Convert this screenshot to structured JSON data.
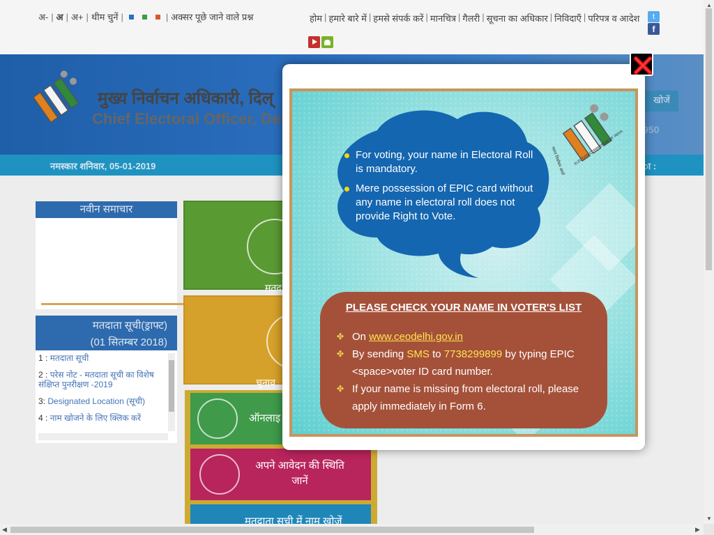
{
  "accessibility": {
    "font_decrease": "अ-",
    "font_normal": "अ",
    "font_increase": "अ+",
    "theme_label": "थीम चुनें",
    "theme_colors": [
      "#2b6fbf",
      "#3f9a4a",
      "#d9572a"
    ],
    "faq": "अक्सर पूछे जाने वाले प्रश्न"
  },
  "topnav": {
    "items": [
      "होम",
      "हमारे बारे में",
      "हमसे संपर्क करें",
      "मानचित्र",
      "गैलरी",
      "सूचना का अधिकार",
      "निविदाएँ",
      "परिपत्र व आदेश"
    ]
  },
  "social": {
    "twitter": "twitter-icon",
    "facebook": "facebook-icon",
    "youtube": "youtube-icon",
    "android": "android-icon"
  },
  "header": {
    "title_hi": "मुख्य निर्वाचन अधिकारी, दिल्",
    "title_en": "Chief Electoral Officer, Del",
    "search_button": "खोजें",
    "helpline_partial": "950"
  },
  "greeting": {
    "text": "नमस्कार शनिवार, 05-01-2019",
    "right": "ा :"
  },
  "news": {
    "heading": "नवीन समाचार"
  },
  "voter_list": {
    "heading_line1": "मतदाता सूची(ड्राफ्ट)",
    "heading_line2": "(01 सितम्बर 2018)",
    "items": [
      {
        "num": "1 :",
        "text": "मतदाता सूची"
      },
      {
        "num": "2 :",
        "text": "परेस नोट - मतदाता सूची का विशेष संक्षिप्त पुनरीक्षण -2019"
      },
      {
        "num": "3:",
        "text": "Designated Location (सूची)"
      },
      {
        "num": "4 :",
        "text": "नाम खोजने के लिए क्लिक करें"
      }
    ]
  },
  "tiles": {
    "tile1_label": "मतद",
    "tile2_label": "चुनाव",
    "s1_label": "ऑनलाइ",
    "s2_label": "अपने आवेदन की स्थिति जानें",
    "s3_label": "मतदाता सूची में नाम खोजें"
  },
  "modal": {
    "bubble_points": [
      "For voting, your name in Electoral Roll is mandatory.",
      "Mere possession of EPIC card without any name in electoral roll does not provide Right to Vote."
    ],
    "check_heading": "PLEASE CHECK YOUR NAME IN VOTER'S LIST",
    "on_prefix": "On",
    "website": "www.ceodelhi.gov.in",
    "sms_prefix": "By sending",
    "sms_word": "SMS",
    "sms_to": "to",
    "sms_number": "7738299899",
    "sms_suffix": "by typing EPIC <space>voter ID card number.",
    "missing_text": "If your name is missing from electoral roll, please apply immediately in Form 6.",
    "eci_logo_text_left": "भारत निर्वाचन आयोग",
    "eci_logo_text_right": "ELECTION COMMISSION OF INDIA"
  }
}
